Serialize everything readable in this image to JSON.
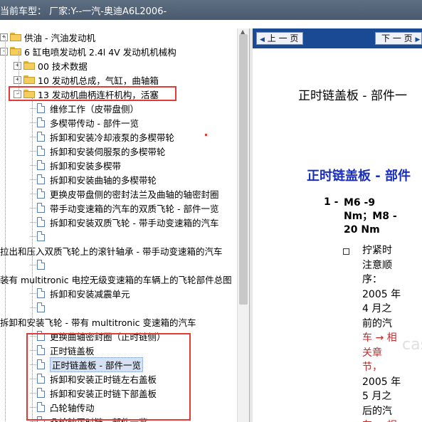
{
  "window": {
    "title": "当前车型：  厂家:Y--一汽-奥迪A6L2006-"
  },
  "tree": {
    "items": [
      {
        "label": "供油 - 汽油发动机",
        "type": "folder",
        "toggle": "+"
      },
      {
        "label": "6 缸电喷发动机 2.4l 4V 发动机机械构",
        "type": "folder",
        "toggle": "-"
      },
      {
        "label": "00 技术数据",
        "type": "folder",
        "toggle": "+"
      },
      {
        "label": "10 发动机总成，气缸，曲轴箱",
        "type": "folder",
        "toggle": "+"
      },
      {
        "label": "13 发动机曲柄连杆机构，活塞",
        "type": "folder",
        "toggle": "-"
      },
      {
        "label": "维修工作（皮带盘侧）",
        "type": "doc"
      },
      {
        "label": "多楔带传动 - 部件一览",
        "type": "doc"
      },
      {
        "label": "拆卸和安装冷却液泵的多楔带轮",
        "type": "doc"
      },
      {
        "label": "拆卸和安装伺服泵的多楔带轮",
        "type": "doc"
      },
      {
        "label": "拆卸和安装多楔带",
        "type": "doc"
      },
      {
        "label": "拆卸和安装曲轴的多楔带轮",
        "type": "doc"
      },
      {
        "label": "更换皮带盘侧的密封法兰及曲轴的轴密封圈",
        "type": "doc"
      },
      {
        "label": "带手动变速箱的汽车的双质飞轮 - 部件一览",
        "type": "doc"
      },
      {
        "label": "拆卸和安装双质飞轮 - 带手动变速箱的汽车",
        "type": "doc"
      },
      {
        "label": "",
        "type": "doc"
      },
      {
        "label": "拉出和压入双质飞轮上的滚针轴承 - 带手动变速箱的汽车",
        "type": "doc"
      },
      {
        "label": "",
        "type": "doc"
      },
      {
        "label": "装有 multitronic 电控无级变速箱的车辆上的飞轮部件总图",
        "type": "doc"
      },
      {
        "label": "拆卸和安装减震单元",
        "type": "doc"
      },
      {
        "label": "",
        "type": "doc"
      },
      {
        "label": "拆卸和安装飞轮 - 带有 multitronic 变速箱的汽车",
        "type": "doc"
      },
      {
        "label": "更换曲轴密封圈（正时链侧）",
        "type": "doc"
      },
      {
        "label": "正时链盖板",
        "type": "doc"
      },
      {
        "label": "正时链盖板 - 部件一览",
        "type": "doc",
        "selected": true
      },
      {
        "label": "拆卸和安装正时链左右盖板",
        "type": "doc"
      },
      {
        "label": "拆卸和安装正时链下部盖板",
        "type": "doc"
      },
      {
        "label": "凸轮轴传动",
        "type": "doc"
      },
      {
        "label": "凸轮轴正时链 - 部件一览",
        "type": "doc"
      },
      {
        "label": "",
        "type": "doc"
      }
    ]
  },
  "nav": {
    "prev_label": "上 一 页",
    "next_label": "下 一 页"
  },
  "content": {
    "heading_main": "正时链盖板 - 部件一",
    "heading_section": "正时链盖板 - 部件",
    "step_number": "1 -",
    "step_lines": [
      "M6 -9",
      "Nm；M8 -",
      "20 Nm"
    ],
    "bullet_lines": [
      {
        "text": "拧紧时",
        "red": false
      },
      {
        "text": "注意顺",
        "red": false
      },
      {
        "text": "序：",
        "red": false
      },
      {
        "text": "2005 年",
        "red": false
      },
      {
        "text": "4 月之",
        "red": false
      },
      {
        "text": "前的汽",
        "red": false
      },
      {
        "text": "车 → 相",
        "red": true
      },
      {
        "text": "关章",
        "red": true
      },
      {
        "text": "节，",
        "red": true
      },
      {
        "text": "2005 年",
        "red": false
      },
      {
        "text": "5 月之",
        "red": false
      },
      {
        "text": "后的汽",
        "red": false
      },
      {
        "text": "车 → 相",
        "red": true
      }
    ]
  },
  "colors": {
    "title_bar": "#56667a",
    "nav_bar": "#1a4a94",
    "section_heading": "#1a2db8",
    "link_red": "#c62828",
    "highlight_box": "#e53935"
  }
}
